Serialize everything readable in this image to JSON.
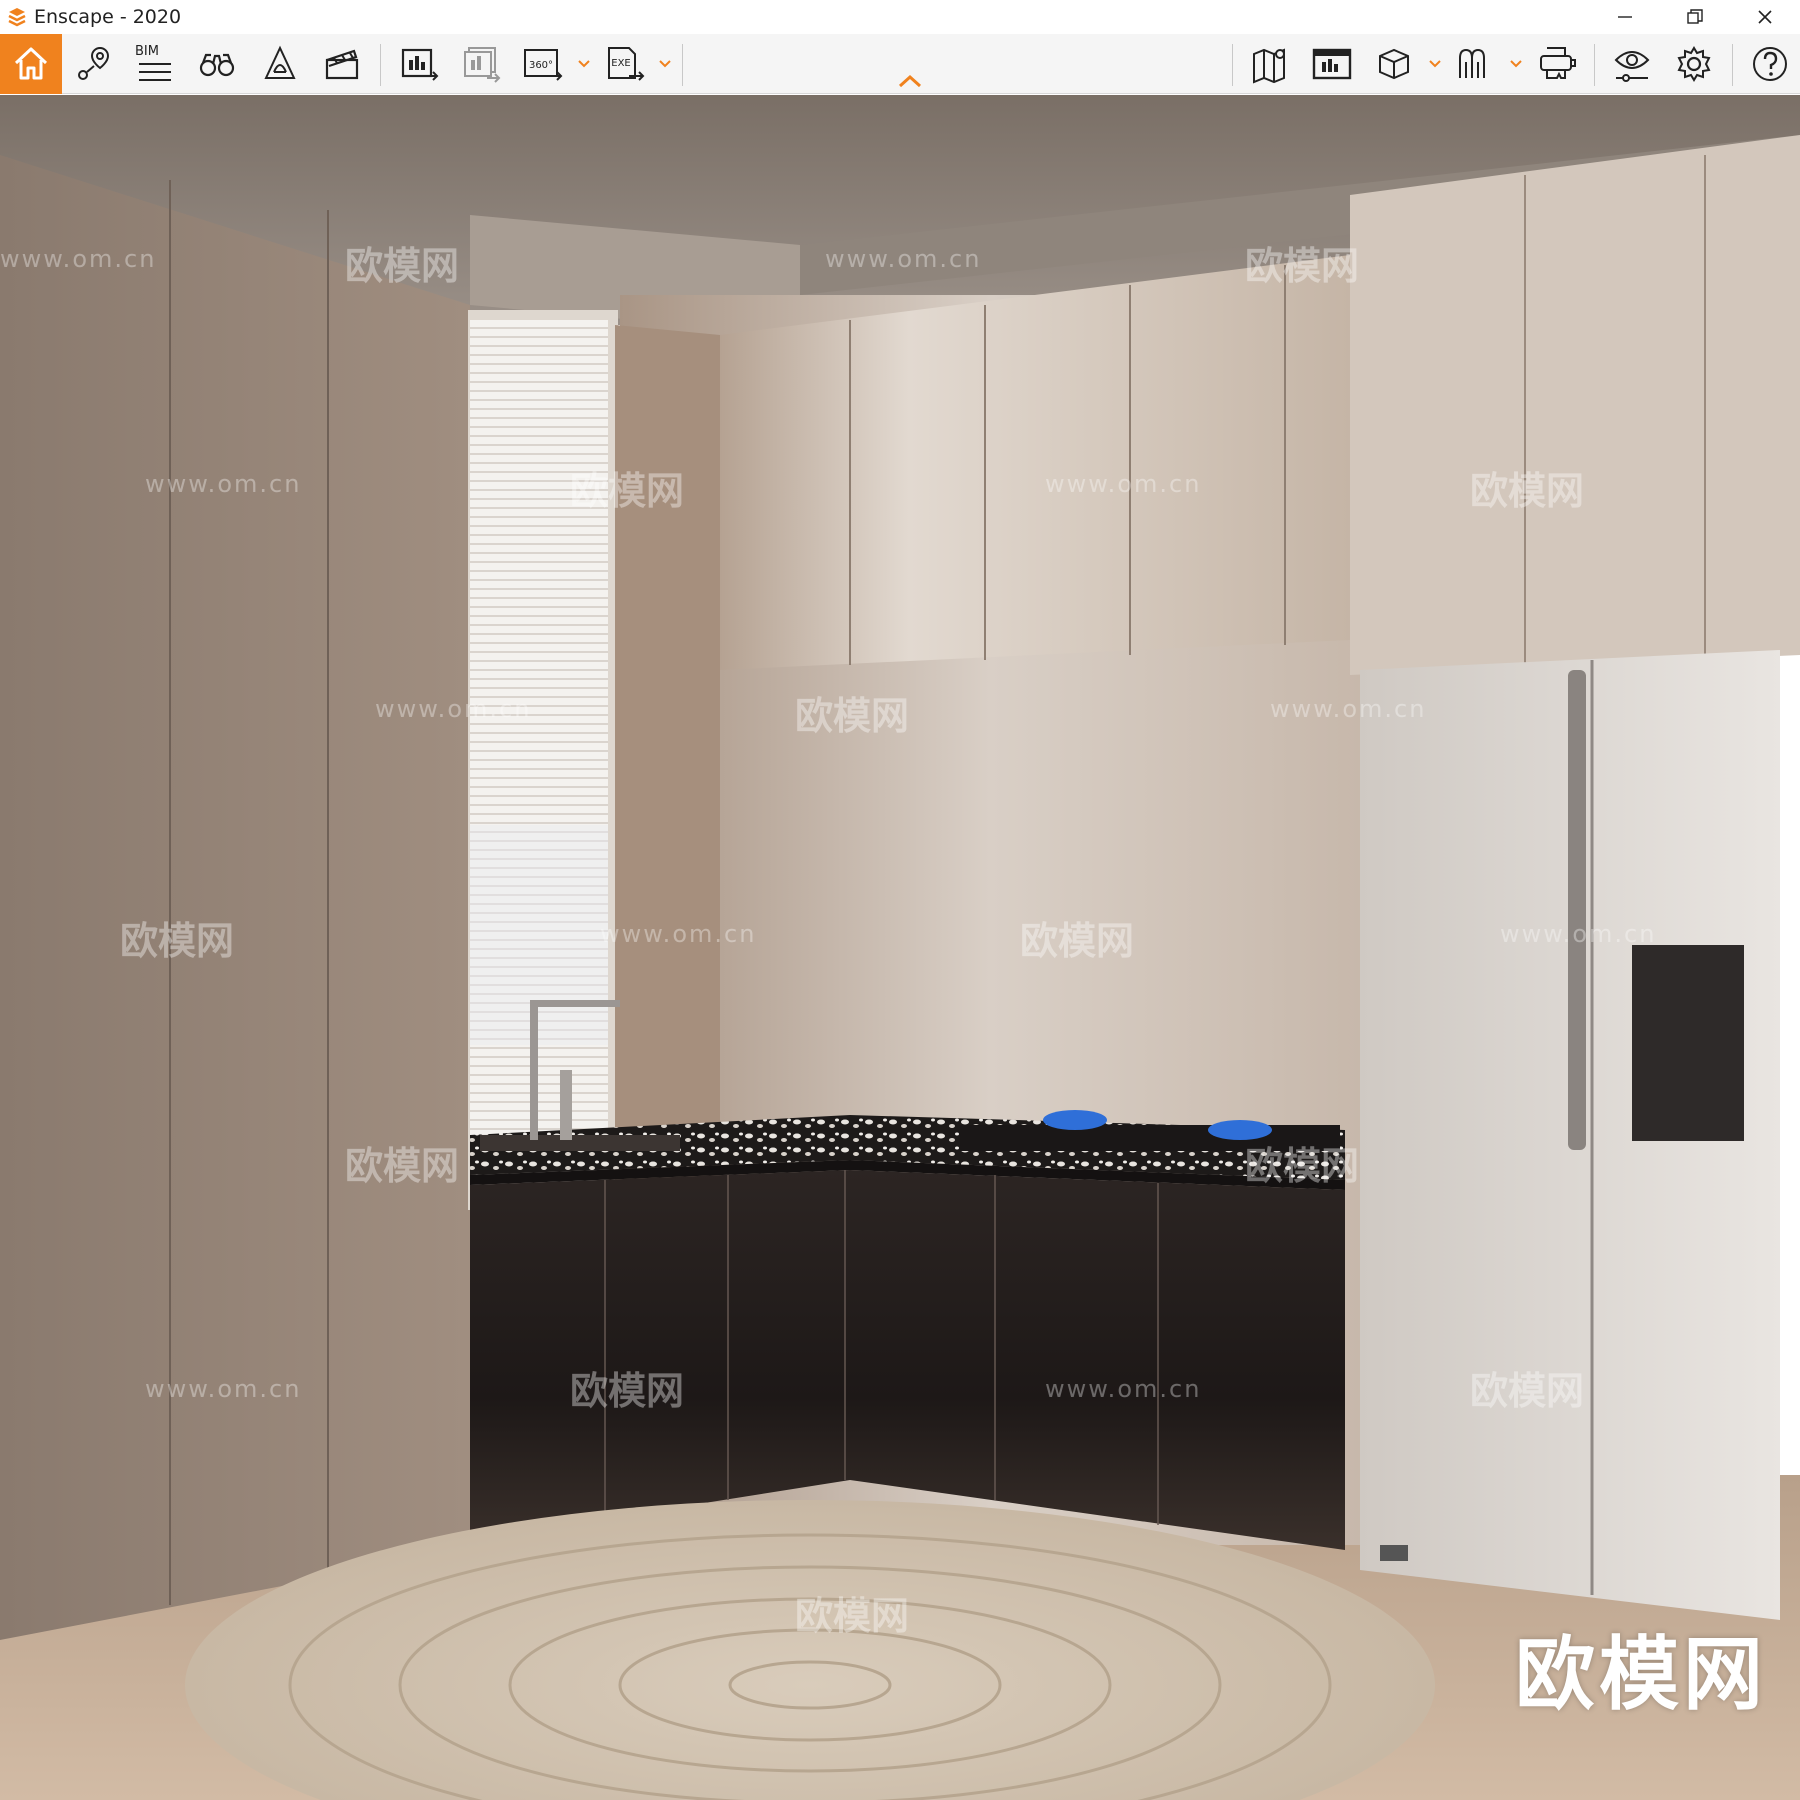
{
  "window": {
    "title": "Enscape - 2020"
  },
  "toolbar": {
    "accent_color": "#f0821e",
    "bim_label": "BIM",
    "screenshot_360_label": "360°",
    "exe_label": "EXE",
    "items": [
      {
        "name": "home",
        "icon": "home-icon"
      },
      {
        "name": "views",
        "icon": "location-pin-icon"
      },
      {
        "name": "bim",
        "icon": "bim-list-icon"
      },
      {
        "name": "binoculars",
        "icon": "binoculars-icon"
      },
      {
        "name": "atmosphere",
        "icon": "bell-shape-icon"
      },
      {
        "name": "video",
        "icon": "clapper-icon"
      },
      {
        "name": "render",
        "icon": "render-export-icon"
      },
      {
        "name": "batch-render",
        "icon": "batch-render-icon"
      },
      {
        "name": "panorama",
        "icon": "panorama-360-icon"
      },
      {
        "name": "exe-export",
        "icon": "exe-export-icon"
      },
      {
        "name": "map",
        "icon": "map-icon"
      },
      {
        "name": "gallery",
        "icon": "gallery-icon"
      },
      {
        "name": "asset-library",
        "icon": "cube-icon"
      },
      {
        "name": "material",
        "icon": "material-icon"
      },
      {
        "name": "vr",
        "icon": "vr-headset-icon"
      },
      {
        "name": "visual-settings",
        "icon": "eye-slider-icon"
      },
      {
        "name": "settings",
        "icon": "gear-icon"
      },
      {
        "name": "help",
        "icon": "help-icon"
      }
    ]
  },
  "viewport": {
    "watermark_site": "www.om.cn",
    "watermark_brand": "欧模网",
    "brand_logo": "欧模网"
  }
}
